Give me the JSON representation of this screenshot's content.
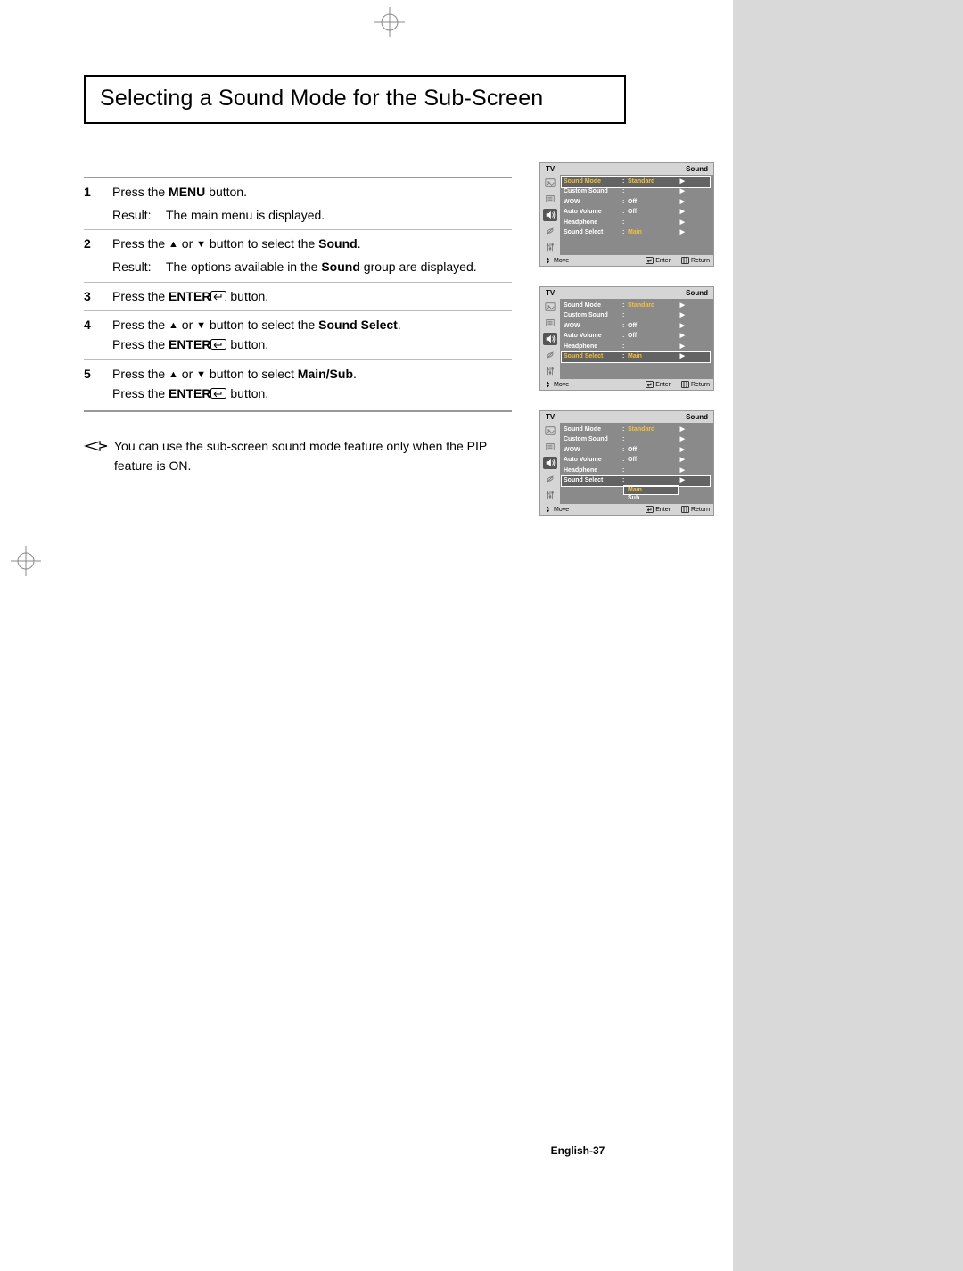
{
  "title": "Selecting a Sound Mode for the Sub-Screen",
  "steps": [
    {
      "num": "1",
      "lines": [
        "Press the <b>MENU</b> button."
      ],
      "result": "The main menu is displayed."
    },
    {
      "num": "2",
      "lines": [
        "Press the ▲ or ▼ button to select the <b>Sound</b>."
      ],
      "result": "The options available in the <b>Sound</b> group are displayed."
    },
    {
      "num": "3",
      "lines": [
        "Press the <b>ENTER</b>⏎ button."
      ]
    },
    {
      "num": "4",
      "lines": [
        "Press the ▲ or ▼ button to select the <b>Sound Select</b>.",
        "Press the <b>ENTER</b>⏎ button."
      ]
    },
    {
      "num": "5",
      "lines": [
        "Press the ▲ or ▼ button to select <b>Main/Sub</b>.",
        "Press the <b>ENTER</b>⏎ button."
      ]
    }
  ],
  "note": "You can use the sub-screen sound mode feature only when the PIP feature is ON.",
  "result_label": "Result:",
  "osd_common": {
    "tv": "TV",
    "section": "Sound",
    "foot_move": "Move",
    "foot_enter": "Enter",
    "foot_return": "Return"
  },
  "osd1_rows": [
    {
      "label": "Sound Mode",
      "val": "Standard",
      "hl": true,
      "yellow": true
    },
    {
      "label": "Custom Sound",
      "val": ""
    },
    {
      "label": "WOW",
      "val": "Off"
    },
    {
      "label": "Auto Volume",
      "val": "Off"
    },
    {
      "label": "Headphone",
      "val": ""
    },
    {
      "label": "Sound Select",
      "val": "Main",
      "yellow": true
    }
  ],
  "osd2_rows": [
    {
      "label": "Sound Mode",
      "val": "Standard",
      "yellow": true
    },
    {
      "label": "Custom Sound",
      "val": ""
    },
    {
      "label": "WOW",
      "val": "Off"
    },
    {
      "label": "Auto Volume",
      "val": "Off"
    },
    {
      "label": "Headphone",
      "val": ""
    },
    {
      "label": "Sound Select",
      "val": "Main",
      "hl": true,
      "yellow": true
    }
  ],
  "osd3_rows": [
    {
      "label": "Sound Mode",
      "val": "Standard",
      "yellow": true
    },
    {
      "label": "Custom Sound",
      "val": ""
    },
    {
      "label": "WOW",
      "val": "Off"
    },
    {
      "label": "Auto Volume",
      "val": "Off"
    },
    {
      "label": "Headphone",
      "val": ""
    },
    {
      "label": "Sound Select",
      "val": "",
      "hl": true
    }
  ],
  "osd3_sub": {
    "opt1": "Main",
    "opt2": "Sub"
  },
  "page_num": "English-37"
}
